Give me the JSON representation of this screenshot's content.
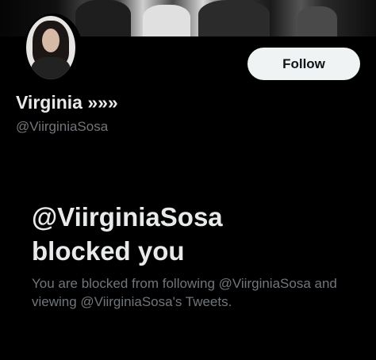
{
  "profile": {
    "display_name": "Virginia »»»",
    "handle": "@ViirginiaSosa",
    "follow_label": "Follow"
  },
  "blocked": {
    "title_line1": "@ViirginiaSosa",
    "title_line2": "blocked you",
    "description": "You are blocked from following @ViirginiaSosa and viewing @ViirginiaSosa's Tweets."
  },
  "colors": {
    "background": "#000000",
    "primary_text": "#e7e9ea",
    "secondary_text": "#71767b",
    "follow_button_bg": "#eff3f4"
  }
}
